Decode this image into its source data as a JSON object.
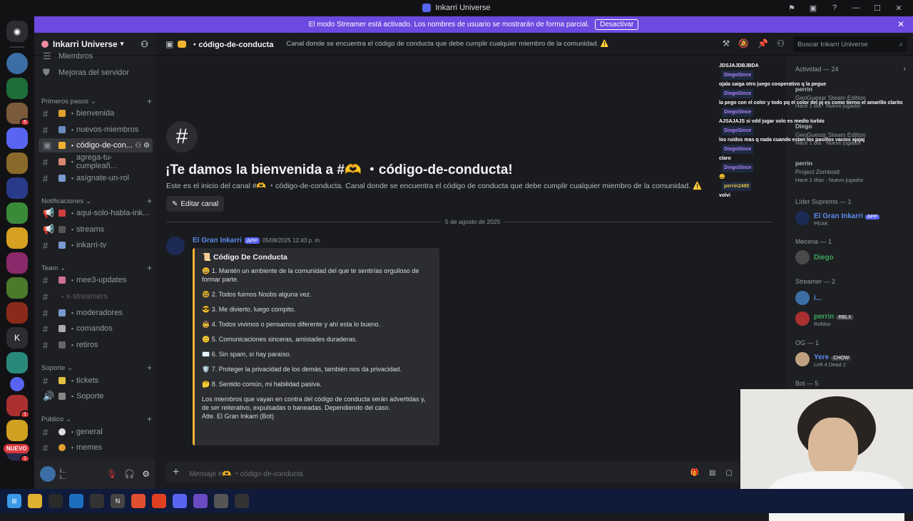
{
  "window": {
    "title": "Inkarri Universe"
  },
  "streamer_bar": {
    "text": "El modo Streamer está activado. Los nombres de usuario se mostrarán de forma parcial.",
    "button": "Desactivar"
  },
  "servers": {
    "nuevo": "NUEVO",
    "letter_k": "K",
    "badges": [
      "5",
      "1",
      "1"
    ]
  },
  "sidebar": {
    "server_name": "Inkarri Universe",
    "top_items": [
      "Miembros",
      "Mejoras del servidor"
    ],
    "categories": [
      "Primeros pasos",
      "Notificaciones",
      "Team",
      "Soporte",
      "Público"
    ],
    "channels": {
      "bienvenida": "bienvenida",
      "nuevos_miembros": "nuevos-miembros",
      "codigo": "código-de-con...",
      "cumple": "agrega-tu-cumpleañ...",
      "rol": "asígnate-un-rol",
      "aqui": "aqui-solo-habla-ink...",
      "streams": "streams",
      "tv": "inkarri-tv",
      "mee6": "mee3-updates",
      "xstreamers": "x-streamers",
      "moderadores": "moderadores",
      "comandos": "comandos",
      "retiros": "retiros",
      "tickets": "tickets",
      "soporte": "Soporte",
      "general": "general",
      "memes": "memes"
    },
    "user": {
      "name": "i...",
      "status": "i..."
    }
  },
  "channel_header": {
    "name": "código-de-conducta",
    "topic": "Canal donde se encuentra el código de conducta que debe cumplir cualquier miembro de la comunidad. ⚠️",
    "search_placeholder": "Buscar Inkarri Universe"
  },
  "welcome": {
    "title": "¡Te damos la bienvenida a #🫶 ・código-de-conducta!",
    "subtitle": "Este es el inicio del canal #🫶 ・código-de-conducta. Canal donde se encuentra el código de conducta que debe cumplir cualquier miembro de la comunidad. ⚠️",
    "edit_button": "Editar canal"
  },
  "date_divider": "5 de agosto de 2025",
  "message": {
    "author": "El Gran Inkarri",
    "tag": "APP",
    "timestamp": "05/08/2025 12:43 p. m.",
    "embed_title": "📜 Código De Conducta",
    "rules": [
      "😃 1. Mantén un ambiente de la comunidad del que te sentirías orgulloso de formar parte.",
      "🤓 2. Todos fuimos Noobs alguna vez.",
      "😎 3. Me divierto, luego compito.",
      "🤠 4. Todos vivimos o pensamos diferente y ahí esta lo bueno.",
      "😊 5. Comunicaciones sinceras, amistades duraderas.",
      "✉️ 6. Sin spam, sí hay paraíso.",
      "🛡️ 7. Proteger la privacidad de los demás, también nos da privacidad.",
      "🤔 8. Sentido común, mi habilidad pasiva."
    ],
    "footer": "Los miembros que vayan en contra del código de conducta serán advertidas y, de ser reiterativo, expulsadas o baneadas. Dependiendo del caso.\nAtte. El Gran Inkarri (Bot)"
  },
  "composer": {
    "placeholder": "Mensaje #🫶 ・código-de-conducta"
  },
  "members": {
    "activity_title": "Actividad — 24",
    "activity": [
      {
        "name": "perrin",
        "game": "GeoGuessr Steam Edition",
        "meta": "Hace 1 día · Nuevo jugador"
      },
      {
        "name": "Diego",
        "game": "GeoGuessr Steam Edition",
        "meta": "Hace 1 día · Nuevo jugador"
      },
      {
        "name": "perrin",
        "game": "Project Zomboid",
        "meta": "Hace 2 días · Nuevo jugador"
      }
    ],
    "groups": [
      {
        "title": "Líder Supremo — 1",
        "members": [
          {
            "name": "El Gran Inkarri",
            "tag": "APP",
            "sub": "PEAK",
            "color": "#5a8dee"
          }
        ]
      },
      {
        "title": "Mecena — 1",
        "members": [
          {
            "name": "Diego",
            "tag": "",
            "sub": "",
            "color": "#3ba55d"
          }
        ]
      },
      {
        "title": "Streamer — 2",
        "members": [
          {
            "name": "i...",
            "tag": "",
            "sub": "",
            "color": "#5a8dee"
          },
          {
            "name": "perrin",
            "tag": "RBLX",
            "sub": "Roblox",
            "color": "#3ba55d"
          }
        ]
      },
      {
        "title": "OG — 1",
        "members": [
          {
            "name": "Yere",
            "tag": "CHOW",
            "sub": "Left 4 Dead 2",
            "color": "#5a8dee"
          }
        ]
      },
      {
        "title": "Bot — 5",
        "members": []
      }
    ]
  },
  "chat_overlay": [
    {
      "text": "JDSJAJDBJBDA",
      "name": ""
    },
    {
      "text": "",
      "name": "DiegoSince"
    },
    {
      "text": "ojala saiga otro juego cooperativo q la pegue",
      "name": ""
    },
    {
      "text": "",
      "name": "DiegoSince"
    },
    {
      "text": "la pego con el color y todo pq el color del pj es como tierno el amarillo clarito",
      "name": ""
    },
    {
      "text": "",
      "name": "DiegoSince"
    },
    {
      "text": "AJSAJAJS si vdd jugar solo es medio turbio",
      "name": ""
    },
    {
      "text": "",
      "name": "DiegoSince"
    },
    {
      "text": "los ruidos mas q nada cuando estan los pasillos vacios ajajaj",
      "name": ""
    },
    {
      "text": "",
      "name": "DiegoSince"
    },
    {
      "text": "claro",
      "name": ""
    },
    {
      "text": "",
      "name": "DiegoSince"
    },
    {
      "text": "😄",
      "name": ""
    },
    {
      "text": "",
      "name": "perrin2490"
    },
    {
      "text": "volvi",
      "name": ""
    }
  ]
}
